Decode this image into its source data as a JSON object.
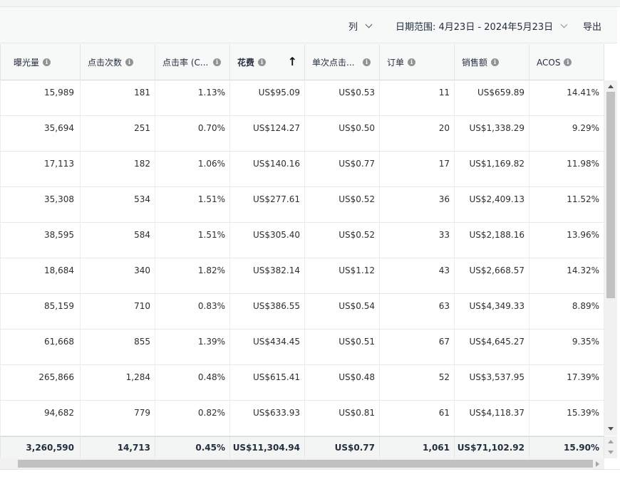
{
  "toolbar": {
    "columns_label": "列",
    "date_range_label": "日期范围: 4月23日 - 2024年5月23日",
    "export_label": "导出"
  },
  "table": {
    "headers": [
      "曝光量",
      "点击次数",
      "点击率 (C...",
      "花费",
      "单次点击...",
      "订单",
      "销售额",
      "ACOS"
    ],
    "sorted_column": "花费",
    "sort_direction": "ascending",
    "rows": [
      [
        "15,989",
        "181",
        "1.13%",
        "US$95.09",
        "US$0.53",
        "11",
        "US$659.89",
        "14.41%"
      ],
      [
        "35,694",
        "251",
        "0.70%",
        "US$124.27",
        "US$0.50",
        "20",
        "US$1,338.29",
        "9.29%"
      ],
      [
        "17,113",
        "182",
        "1.06%",
        "US$140.16",
        "US$0.77",
        "17",
        "US$1,169.82",
        "11.98%"
      ],
      [
        "35,308",
        "534",
        "1.51%",
        "US$277.61",
        "US$0.52",
        "36",
        "US$2,409.13",
        "11.52%"
      ],
      [
        "38,595",
        "584",
        "1.51%",
        "US$305.40",
        "US$0.52",
        "33",
        "US$2,188.16",
        "13.96%"
      ],
      [
        "18,684",
        "340",
        "1.82%",
        "US$382.14",
        "US$1.12",
        "43",
        "US$2,668.57",
        "14.32%"
      ],
      [
        "85,159",
        "710",
        "0.83%",
        "US$386.55",
        "US$0.54",
        "63",
        "US$4,349.33",
        "8.89%"
      ],
      [
        "61,668",
        "855",
        "1.39%",
        "US$434.45",
        "US$0.51",
        "67",
        "US$4,645.27",
        "9.35%"
      ],
      [
        "265,866",
        "1,284",
        "0.48%",
        "US$615.41",
        "US$0.48",
        "52",
        "US$3,537.95",
        "17.39%"
      ],
      [
        "94,682",
        "779",
        "0.82%",
        "US$633.93",
        "US$0.81",
        "61",
        "US$4,118.37",
        "15.39%"
      ]
    ],
    "totals": [
      "3,260,590",
      "14,713",
      "0.45%",
      "US$11,304.94",
      "US$0.77",
      "1,061",
      "US$71,102.92",
      "15.90%"
    ]
  }
}
